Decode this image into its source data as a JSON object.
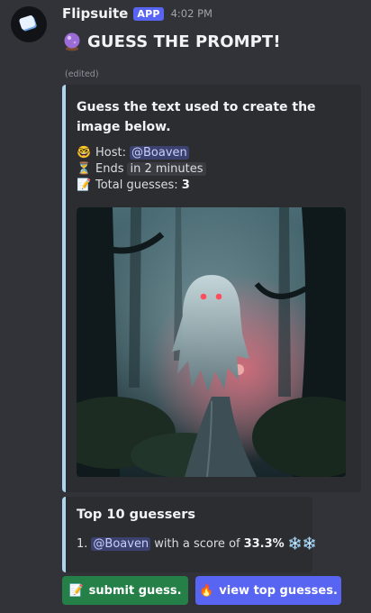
{
  "message": {
    "username": "Flipsuite",
    "app_tag": "APP",
    "timestamp": "4:02 PM",
    "title_icon": "crystal-ball-icon",
    "title": "GUESS THE PROMPT!",
    "edited": "(edited)"
  },
  "embed": {
    "description": "Guess the text used to create the image below.",
    "host_label": "Host:",
    "host_mention": "@Boaven",
    "ends_label": "Ends",
    "ends_value": "in 2 minutes",
    "total_label": "Total guesses:",
    "total_value": "3",
    "image_icon": "ghost-in-forest-image",
    "accent_color": "#aed3ec"
  },
  "leaderboard": {
    "title": "Top 10 guessers",
    "entries": [
      {
        "rank": "1.",
        "mention": "@Boaven",
        "text": "with a score of",
        "score": "33.3%"
      }
    ]
  },
  "buttons": {
    "submit_label": "submit guess.",
    "view_label": "view top guesses.",
    "submit_color": "#248046",
    "view_color": "#5865f2"
  }
}
